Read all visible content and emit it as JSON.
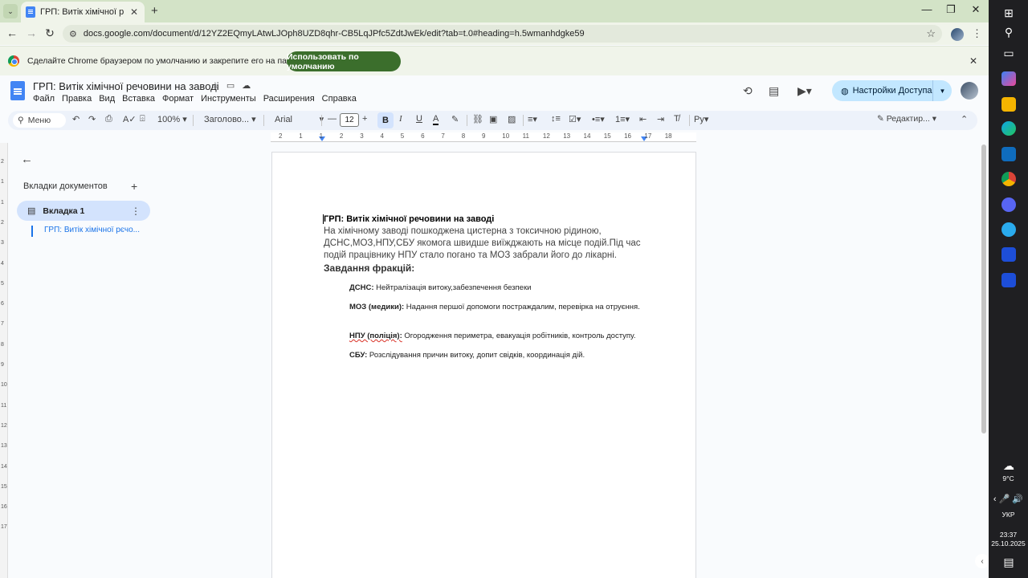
{
  "browser": {
    "tab_title": "ГРП: Витік хімічної речовини - Google Docs",
    "url": "docs.google.com/document/d/12YZ2EQmyLAtwLJOph8UZD8qhr-CB5LqJPfc5ZdtJwEk/edit?tab=t.0#heading=h.5wmanhdgke59"
  },
  "infobar": {
    "text": "Сделайте Chrome браузером по умолчанию и закрепите его на панели задач.",
    "button": "Использовать по умолчанию"
  },
  "docs": {
    "title": "ГРП: Витік хімічної речовини на заводі",
    "menu": [
      "Файл",
      "Правка",
      "Вид",
      "Вставка",
      "Формат",
      "Инструменты",
      "Расширения",
      "Справка"
    ],
    "share_label": "Настройки Доступа"
  },
  "toolbar": {
    "search": "Меню",
    "zoom": "100%",
    "style": "Заголово...",
    "font": "Arial",
    "font_size": "12",
    "mode": "Редактир..."
  },
  "sidebar": {
    "heading": "Вкладки документов",
    "tab_label": "Вкладка 1",
    "outline_item": "ГРП: Витік хімічної рєчо..."
  },
  "document": {
    "title": "ГРП: Витік хімічної речовини на заводі",
    "intro": " На хімічному заводі пошкоджена цистерна з токсичною рідиною, ДСНС,МОЗ,НПУ,СБУ якомога швидше виїжджають на місце подій.Під час подій працівнику НПУ стало погано та МОЗ забрали його до лікарні.",
    "tasks_heading": "Завдання фракцій:",
    "factions": [
      {
        "name": "ДСНС:",
        "text": " Нейтралізація витоку,забезпечення безпеки"
      },
      {
        "name": "МОЗ (медики):",
        "text": " Надання першої допомоги постраждалим, перевірка на отруєння."
      },
      {
        "name": "НПУ (поліція):",
        "text": " Огородження периметра, евакуація робітників, контроль доступу."
      },
      {
        "name": "СБУ:",
        "text": " Розслідування причин витоку, допит свідків, координація дій."
      }
    ]
  },
  "ruler": [
    "2",
    "1",
    "1",
    "2",
    "3",
    "4",
    "5",
    "6",
    "7",
    "8",
    "9",
    "10",
    "11",
    "12",
    "13",
    "14",
    "15",
    "16",
    "17",
    "18"
  ],
  "vruler": [
    "2",
    "1",
    "1",
    "2",
    "3",
    "4",
    "5",
    "6",
    "7",
    "8",
    "9",
    "10",
    "11",
    "12",
    "13",
    "14",
    "15",
    "16",
    "17"
  ],
  "taskbar": {
    "weather": "9°C",
    "lang": "УКР",
    "time": "23:37",
    "date": "25.10.2025"
  }
}
